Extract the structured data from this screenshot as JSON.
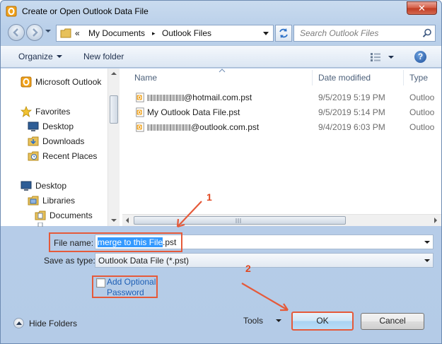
{
  "window": {
    "title": "Create or Open Outlook Data File",
    "close_glyph": "✕"
  },
  "address": {
    "overflow": "«",
    "crumbs": [
      "My Documents",
      "Outlook Files"
    ],
    "separator": "▸"
  },
  "search": {
    "placeholder": "Search Outlook Files"
  },
  "toolbar": {
    "organize": "Organize",
    "new_folder": "New folder",
    "help": "?"
  },
  "nav": {
    "items": [
      {
        "label": "Microsoft Outlook",
        "icon": "outlook-icon"
      },
      {
        "label": "Favorites",
        "icon": "star-icon"
      },
      {
        "label": "Desktop",
        "icon": "desktop-icon"
      },
      {
        "label": "Downloads",
        "icon": "downloads-icon"
      },
      {
        "label": "Recent Places",
        "icon": "recent-places-icon"
      },
      {
        "label": "Desktop",
        "icon": "desktop-icon"
      },
      {
        "label": "Libraries",
        "icon": "libraries-icon"
      },
      {
        "label": "Documents",
        "icon": "documents-icon"
      }
    ]
  },
  "columns": {
    "name": "Name",
    "date": "Date modified",
    "type": "Type"
  },
  "files": [
    {
      "name": "@hotmail.com.pst",
      "date": "9/5/2019 5:19 PM",
      "type": "Outloo",
      "redacted": true
    },
    {
      "name": "My Outlook Data File.pst",
      "date": "9/5/2019 5:14 PM",
      "type": "Outloo",
      "redacted": false
    },
    {
      "name": "@outlook.com.pst",
      "date": "9/4/2019 6:03 PM",
      "type": "Outloo",
      "redacted": true
    }
  ],
  "form": {
    "file_name_label": "File name:",
    "file_name_selected": "merge to this File",
    "file_name_rest": ".pst",
    "save_as_label": "Save as type:",
    "save_as_value": "Outlook Data File (*.pst)",
    "optional_password_line1": "Add Optional",
    "optional_password_line2": "Password"
  },
  "footer": {
    "hide_folders": "Hide Folders",
    "tools": "Tools",
    "ok": "OK",
    "cancel": "Cancel"
  },
  "annotations": {
    "step1": "1",
    "step2": "2"
  },
  "colors": {
    "highlight": "#e55a3a",
    "selection": "#3399ff",
    "link": "#1f5fb5"
  }
}
